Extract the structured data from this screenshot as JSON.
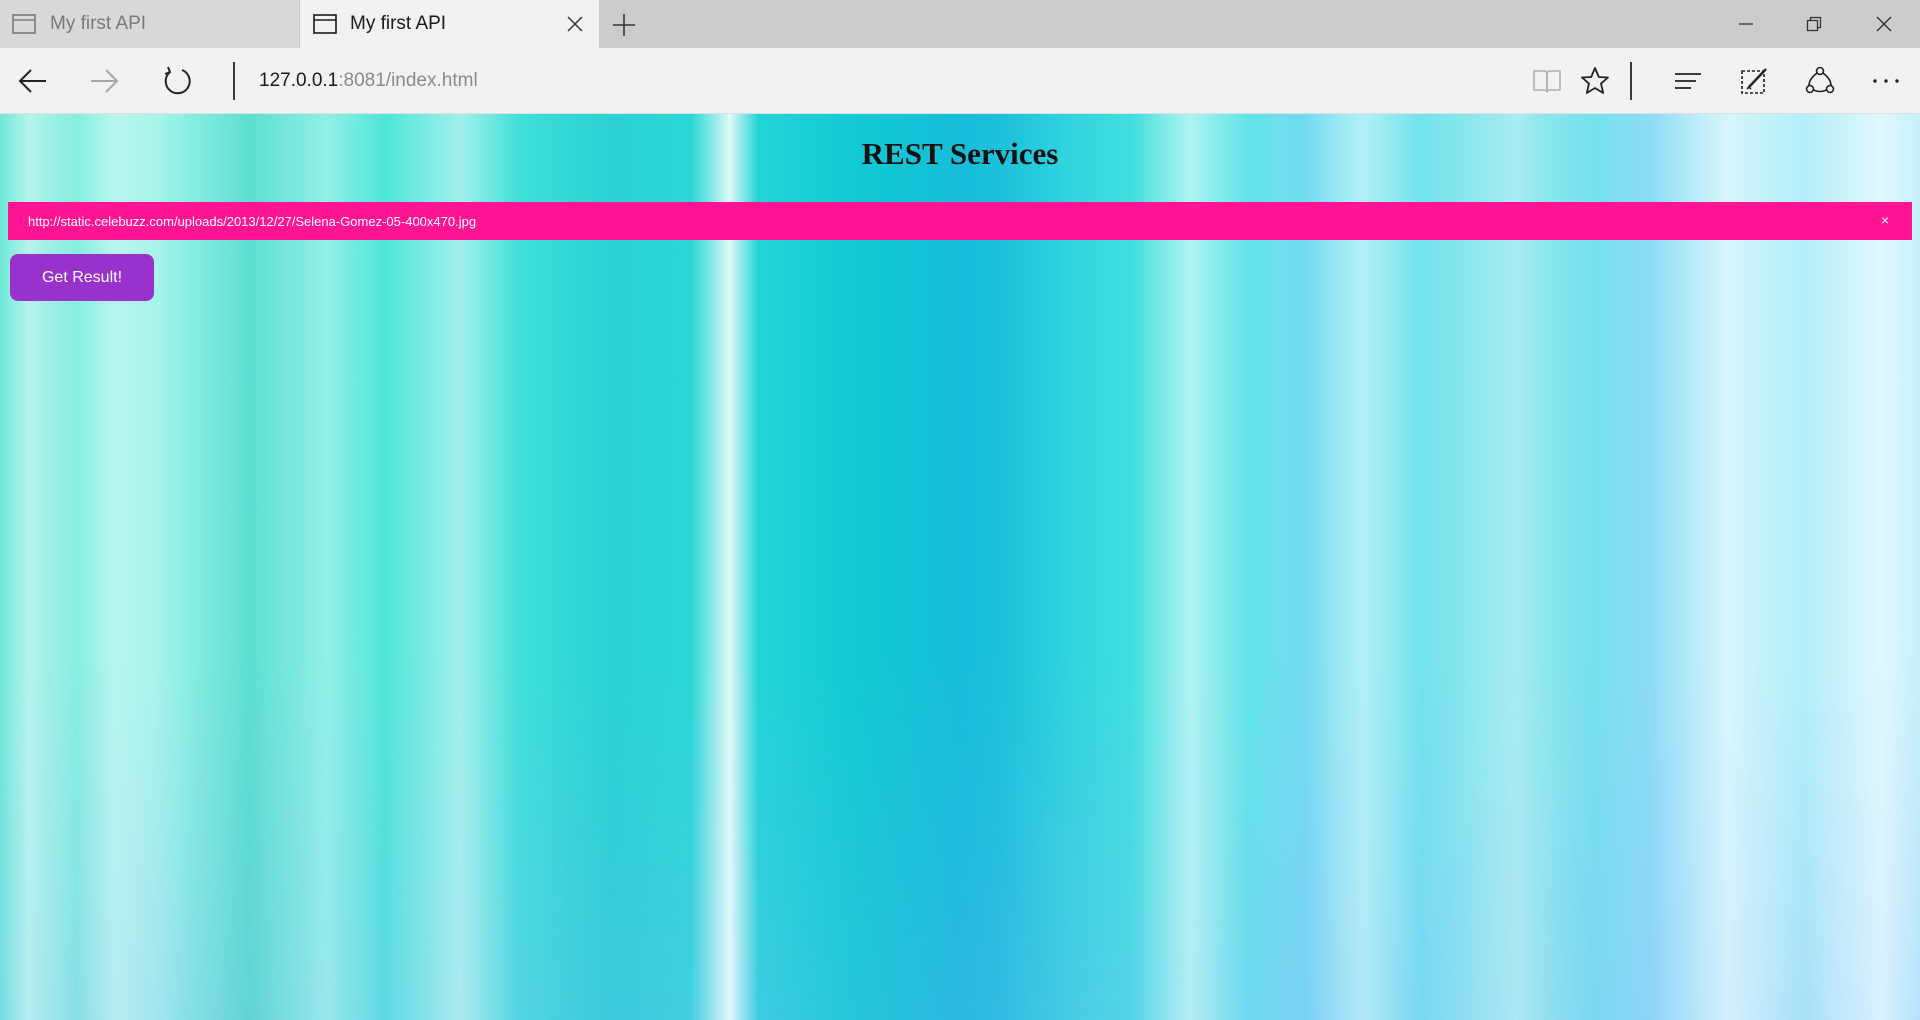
{
  "browser": {
    "tabs": [
      {
        "title": "My first API",
        "active": false
      },
      {
        "title": "My first API",
        "active": true
      }
    ],
    "address": {
      "host": "127.0.0.1",
      "rest": ":8081/index.html"
    }
  },
  "page": {
    "title": "REST Services",
    "url_input_value": "http://static.celebuzz.com/uploads/2013/12/27/Selena-Gomez-05-400x470.jpg",
    "submit_label": "Get Result!",
    "clear_glyph": "×"
  },
  "colors": {
    "input_bg": "#ff1493",
    "button_bg": "#9932cc"
  },
  "icons": [
    "tab-page-icon",
    "close-icon",
    "plus-icon",
    "minimize-icon",
    "restore-icon",
    "back-arrow-icon",
    "forward-arrow-icon",
    "refresh-icon",
    "reading-view-icon",
    "star-icon",
    "hub-icon",
    "web-note-icon",
    "share-icon",
    "more-icon"
  ]
}
